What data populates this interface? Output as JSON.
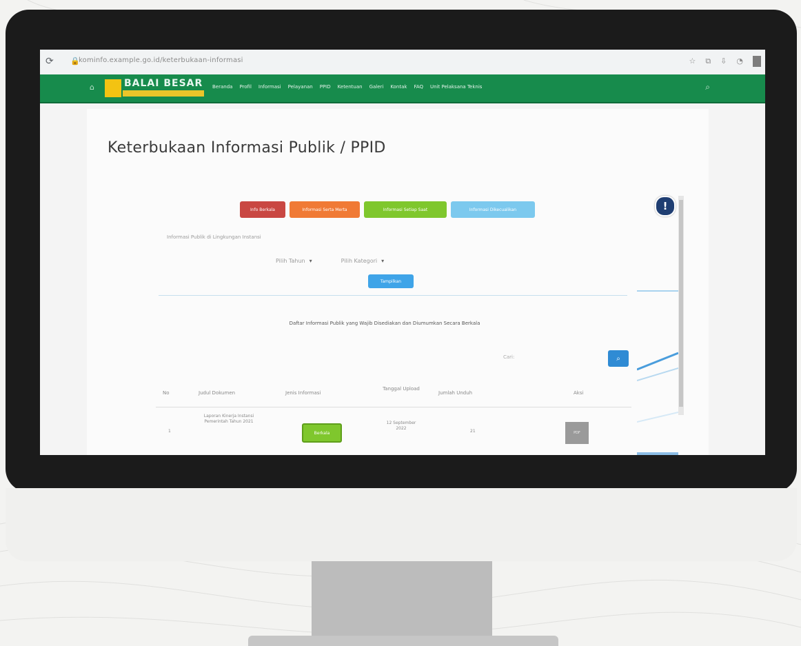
{
  "browser": {
    "url": "kominfo.example.go.id/keterbukaan-informasi",
    "toolbar_icons": [
      "star-icon",
      "extensions-icon",
      "download-icon",
      "profile-icon"
    ]
  },
  "site_nav": {
    "logo_text": "BALAI BESAR",
    "menu_items": [
      "Beranda",
      "Profil",
      "Informasi",
      "Pelayanan",
      "PPID",
      "Ketentuan",
      "Galeri",
      "Kontak",
      "FAQ",
      "Unit Pelaksana Teknis"
    ]
  },
  "page": {
    "title": "Keterbukaan Informasi Publik / PPID",
    "tab_buttons": [
      "Info Berkala",
      "Informasi Serta Merta",
      "Informasi Setiap Saat",
      "Informasi Dikecualikan"
    ],
    "subtitle": "Informasi Publik di Lingkungan Instansi",
    "filter_year_label": "Pilih Tahun",
    "filter_category_label": "Pilih Kategori",
    "filter_button": "Tampilkan",
    "section_title": "Daftar Informasi Publik yang Wajib Disediakan dan Diumumkan Secara Berkala",
    "search_label": "Cari:",
    "table": {
      "headers": [
        "No",
        "Judul Dokumen",
        "Jenis Informasi",
        "Tanggal Upload",
        "Jumlah Unduh",
        "Aksi"
      ],
      "rows": [
        {
          "no": "1",
          "title": "Laporan Kinerja Instansi Pemerintah Tahun 2021",
          "category": "Berkala",
          "date": "12 September 2022",
          "count": "21",
          "thumb": "PDF"
        }
      ]
    }
  },
  "colors": {
    "nav_green": "#178b4c",
    "btn_red": "#c94742",
    "btn_orange": "#f07a35",
    "btn_green": "#7fc72d",
    "btn_lightblue": "#7cc9ee",
    "btn_blue": "#3fa4e8"
  }
}
